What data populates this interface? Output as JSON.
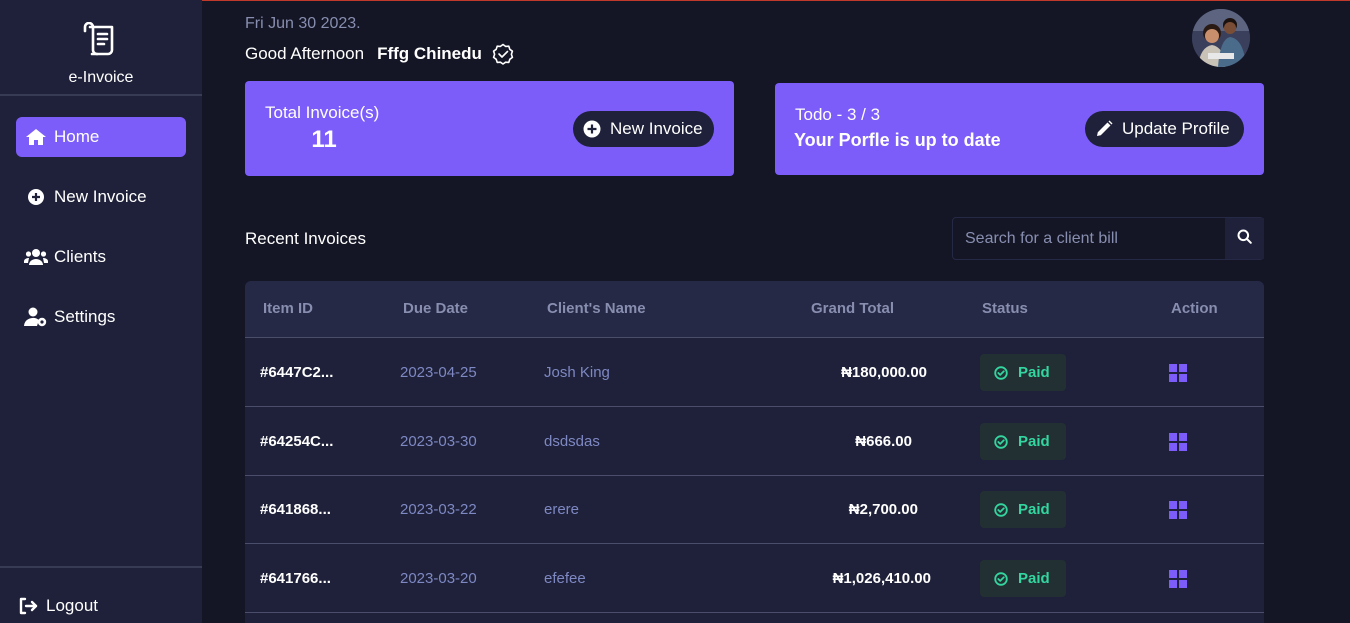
{
  "app": {
    "name": "e-Invoice"
  },
  "nav": {
    "items": [
      {
        "label": "Home",
        "icon": "home-icon",
        "active": true
      },
      {
        "label": "New Invoice",
        "icon": "plus-circle-icon",
        "active": false
      },
      {
        "label": "Clients",
        "icon": "users-icon",
        "active": false
      },
      {
        "label": "Settings",
        "icon": "user-gear-icon",
        "active": false
      }
    ],
    "logout_label": "Logout"
  },
  "header": {
    "date": "Fri Jun 30 2023.",
    "greeting": "Good Afternoon",
    "user_name": "Fffg Chinedu"
  },
  "cards": {
    "invoices": {
      "label": "Total Invoice(s)",
      "count": "11",
      "button_label": "New Invoice"
    },
    "todo": {
      "label": "Todo - 3 / 3",
      "status": "Your Porfle is up to date",
      "button_label": "Update Profile"
    }
  },
  "recent": {
    "title": "Recent Invoices",
    "search_placeholder": "Search for a client bill"
  },
  "table": {
    "columns": [
      "Item ID",
      "Due Date",
      "Client's Name",
      "Grand Total",
      "Status",
      "Action"
    ],
    "rows": [
      {
        "id": "#6447C2...",
        "due_date": "2023-04-25",
        "client": "Josh King",
        "total": "₦180,000.00",
        "status": "Paid"
      },
      {
        "id": "#64254C...",
        "due_date": "2023-03-30",
        "client": "dsdsdas",
        "total": "₦666.00",
        "status": "Paid"
      },
      {
        "id": "#641868...",
        "due_date": "2023-03-22",
        "client": "erere",
        "total": "₦2,700.00",
        "status": "Paid"
      },
      {
        "id": "#641766...",
        "due_date": "2023-03-20",
        "client": "efefee",
        "total": "₦1,026,410.00",
        "status": "Paid"
      }
    ]
  },
  "colors": {
    "accent": "#7c5dfa",
    "background": "#141625",
    "sidebar": "#1e2139",
    "paid": "#33d69f"
  }
}
